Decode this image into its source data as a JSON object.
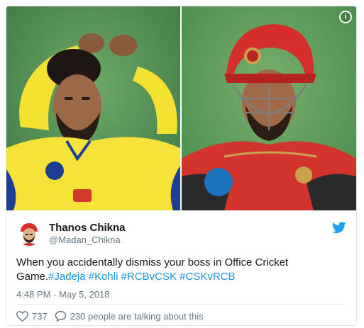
{
  "tweet": {
    "author": {
      "display_name": "Thanos Chikna",
      "handle": "@Madan_Chikna"
    },
    "text_prefix": "When you accidentally dismiss your boss in Office Cricket Game.",
    "hashtags": [
      "#Jadeja",
      "#Kohli",
      "#RCBvCSK",
      "#CSKvRCB"
    ],
    "timestamp": "4:48 PM - May 5, 2018",
    "likes": "737",
    "talking": "230 people are talking about this"
  },
  "icons": {
    "info": "info-icon",
    "twitter": "twitter-bird-icon",
    "like": "heart-icon",
    "reply": "speech-bubble-icon"
  },
  "colors": {
    "link": "#1b95e0",
    "twitter_blue": "#1da1f2",
    "text": "#14171a",
    "muted": "#657786",
    "csk_yellow": "#f5e33a",
    "rcb_red": "#d3332d"
  }
}
